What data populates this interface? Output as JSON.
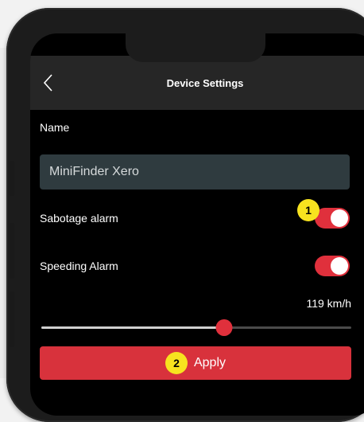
{
  "header": {
    "title": "Device Settings",
    "back_icon": "chevron-left-icon"
  },
  "name_field": {
    "label": "Name",
    "value": "MiniFinder Xero"
  },
  "sabotage_alarm": {
    "label": "Sabotage alarm",
    "enabled": true,
    "badge": "1"
  },
  "speeding_alarm": {
    "label": "Speeding Alarm",
    "enabled": true
  },
  "speed": {
    "value_text": "119 km/h",
    "slider_fraction": 0.59
  },
  "apply": {
    "label": "Apply",
    "badge": "2"
  },
  "colors": {
    "accent": "#e0303c",
    "badge": "#f7e31f",
    "input_bg": "#2f3b3f"
  }
}
